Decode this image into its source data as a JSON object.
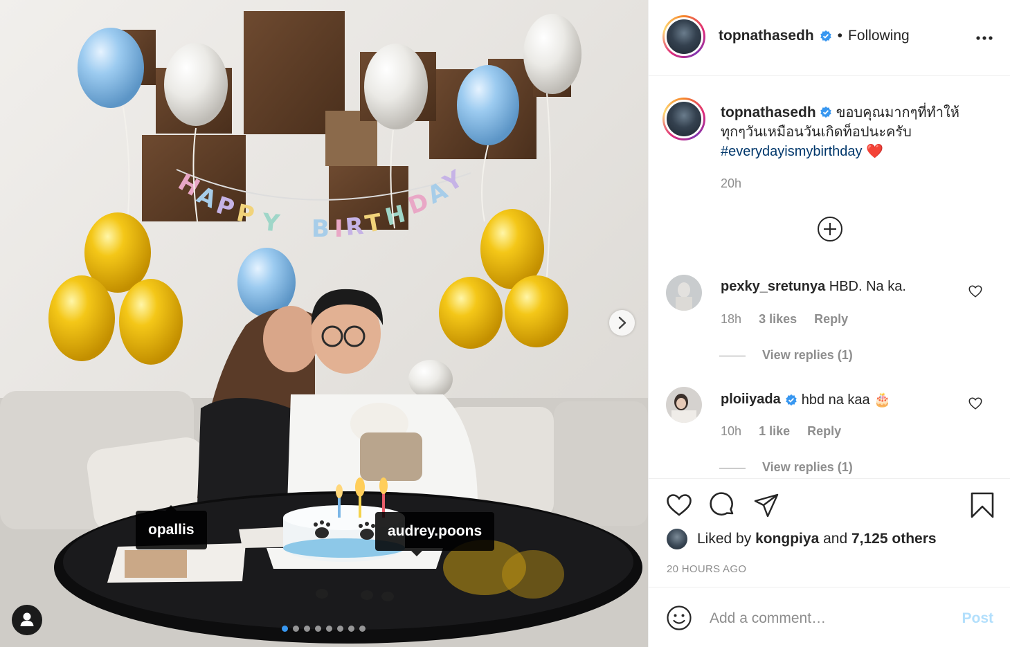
{
  "photo": {
    "banner_text": "HAPPY BIRTHDAY",
    "tags": [
      "opallis",
      "audrey.poons"
    ],
    "carousel": {
      "total": 8,
      "active_index": 0
    }
  },
  "header": {
    "username": "topnathasedh",
    "separator": "•",
    "follow_status": "Following"
  },
  "caption": {
    "username": "topnathasedh",
    "text": "ขอบคุณมากๆที่ทำให้ทุกๆวันเหมือนวันเกิดท็อปนะครับ",
    "hashtag": "#everydayismybirthday",
    "emoji": "❤️",
    "time": "20h"
  },
  "comments": [
    {
      "username": "pexky_sretunya",
      "verified": false,
      "text": "HBD. Na ka.",
      "time": "18h",
      "likes": "3 likes",
      "reply": "Reply",
      "view_replies": "View replies (1)"
    },
    {
      "username": "ploiiyada",
      "verified": true,
      "text": "hbd na kaa 🎂",
      "time": "10h",
      "likes": "1 like",
      "reply": "Reply",
      "view_replies": "View replies (1)"
    }
  ],
  "likes": {
    "prefix": "Liked by",
    "user": "kongpiya",
    "and": "and",
    "others": "7,125 others"
  },
  "posted_ago": "20 HOURS AGO",
  "add_comment": {
    "placeholder": "Add a comment…",
    "post_label": "Post"
  },
  "colors": {
    "accent": "#3897f0",
    "hashtag": "#00376b",
    "muted": "#8e8e8e",
    "post_disabled": "#b2dffc",
    "verified": "#3897f0"
  }
}
